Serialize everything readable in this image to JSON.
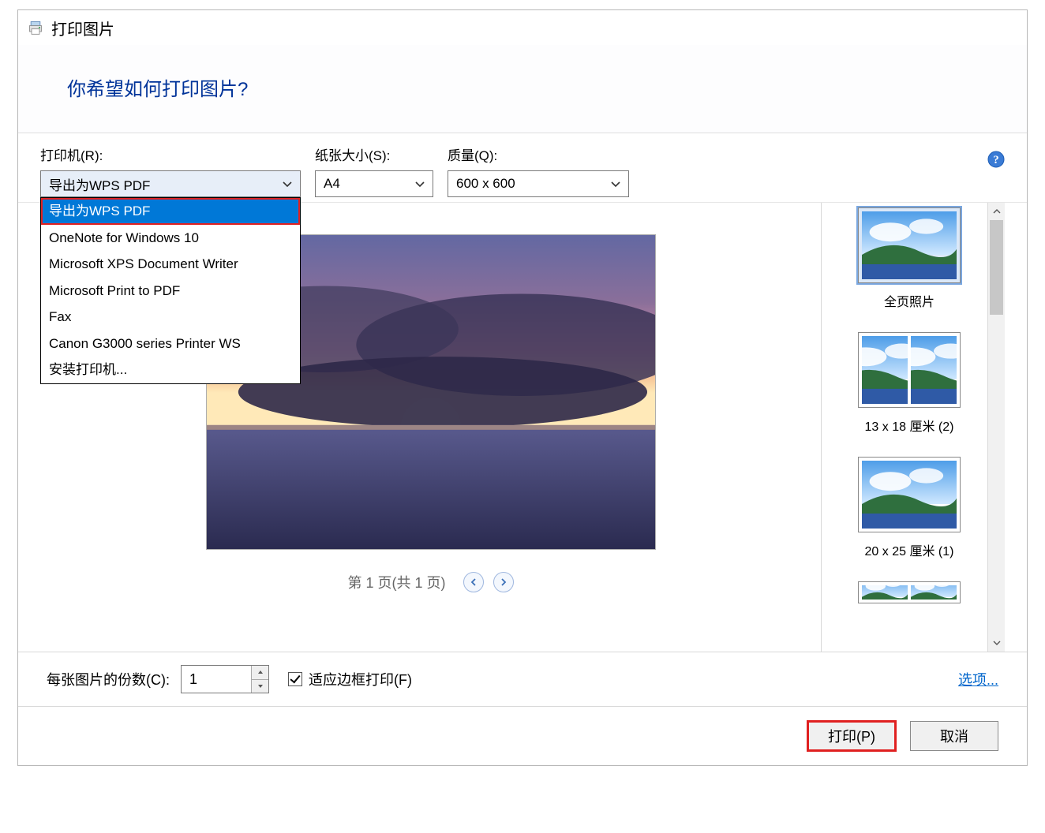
{
  "titlebar": {
    "title": "打印图片"
  },
  "heading": "你希望如何打印图片?",
  "labels": {
    "printer": "打印机(R):",
    "paper": "纸张大小(S):",
    "quality": "质量(Q):"
  },
  "selected": {
    "printer": "导出为WPS PDF",
    "paper": "A4",
    "quality": "600 x 600"
  },
  "printer_options": [
    "导出为WPS PDF",
    "OneNote for Windows 10",
    "Microsoft XPS Document Writer",
    "Microsoft Print to PDF",
    "Fax",
    "Canon G3000 series Printer WS",
    "安装打印机..."
  ],
  "pager": {
    "text": "第 1 页(共 1 页)"
  },
  "layouts": [
    {
      "caption": "全页照片",
      "selected": true,
      "thumbs": 1
    },
    {
      "caption": "13 x 18 厘米 (2)",
      "selected": false,
      "thumbs": 2
    },
    {
      "caption": "20 x 25 厘米 (1)",
      "selected": false,
      "thumbs": 1
    },
    {
      "caption": "",
      "selected": false,
      "thumbs": 2,
      "peek": true
    }
  ],
  "bottom": {
    "copies_label": "每张图片的份数(C):",
    "copies_value": "1",
    "fit_label": "适应边框打印(F)",
    "fit_checked": true,
    "options_link": "选项..."
  },
  "actions": {
    "print": "打印(P)",
    "cancel": "取消"
  }
}
